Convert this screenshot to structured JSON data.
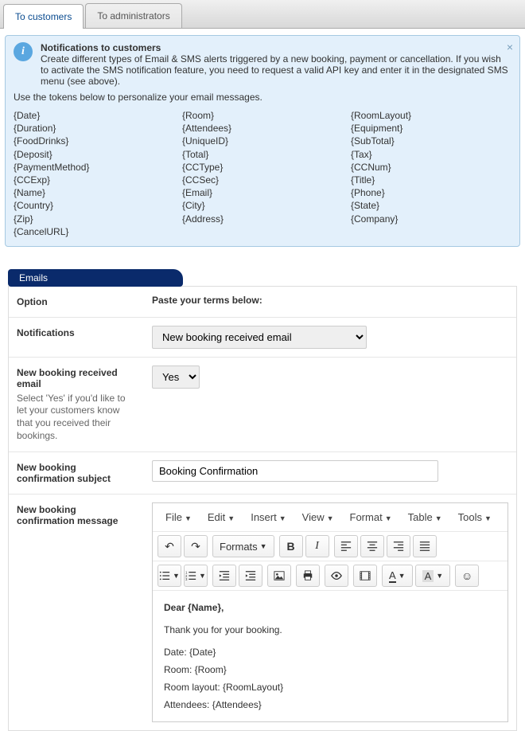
{
  "tabs": {
    "customers": "To customers",
    "admins": "To administrators"
  },
  "info": {
    "title": "Notifications to customers",
    "desc": "Create different types of Email & SMS alerts triggered by a new booking, payment or cancellation. If you wish to activate the SMS notification feature, you need to request a valid API key and enter it in the designated SMS menu (see above).",
    "sub": "Use the tokens below to personalize your email messages.",
    "tokens_col1": [
      "{Date}",
      "{Duration}",
      "{FoodDrinks}",
      "{Deposit}",
      "{PaymentMethod}",
      "{CCExp}",
      "{Name}",
      "{Country}",
      "{Zip}",
      "{CancelURL}"
    ],
    "tokens_col2": [
      "{Room}",
      "{Attendees}",
      "{UniqueID}",
      "{Total}",
      "{CCType}",
      "{CCSec}",
      "{Email}",
      "{City}",
      "{Address}"
    ],
    "tokens_col3": [
      "{RoomLayout}",
      "{Equipment}",
      "{SubTotal}",
      "{Tax}",
      "{CCNum}",
      "{Title}",
      "{Phone}",
      "{State}",
      "{Company}"
    ]
  },
  "section": {
    "emails": "Emails"
  },
  "grid": {
    "option": "Option",
    "paste": "Paste your terms below:",
    "notifications_label": "Notifications",
    "notifications_value": "New booking received email",
    "received_label": "New booking received email",
    "received_hint": "Select 'Yes' if you'd like to let your customers know that you received their bookings.",
    "received_value": "Yes",
    "subject_label": "New booking confirmation subject",
    "subject_value": "Booking Confirmation",
    "message_label": "New booking confirmation message"
  },
  "editor_menu": {
    "file": "File",
    "edit": "Edit",
    "insert": "Insert",
    "view": "View",
    "format": "Format",
    "table": "Table",
    "tools": "Tools"
  },
  "editor_toolbar": {
    "formats": "Formats",
    "color_letter": "A"
  },
  "editor_body": {
    "l1": "Dear {Name},",
    "l2": "Thank you for your booking.",
    "l3": "Date: {Date}",
    "l4": "Room: {Room}",
    "l5": "Room layout: {RoomLayout}",
    "l6": "Attendees: {Attendees}"
  }
}
